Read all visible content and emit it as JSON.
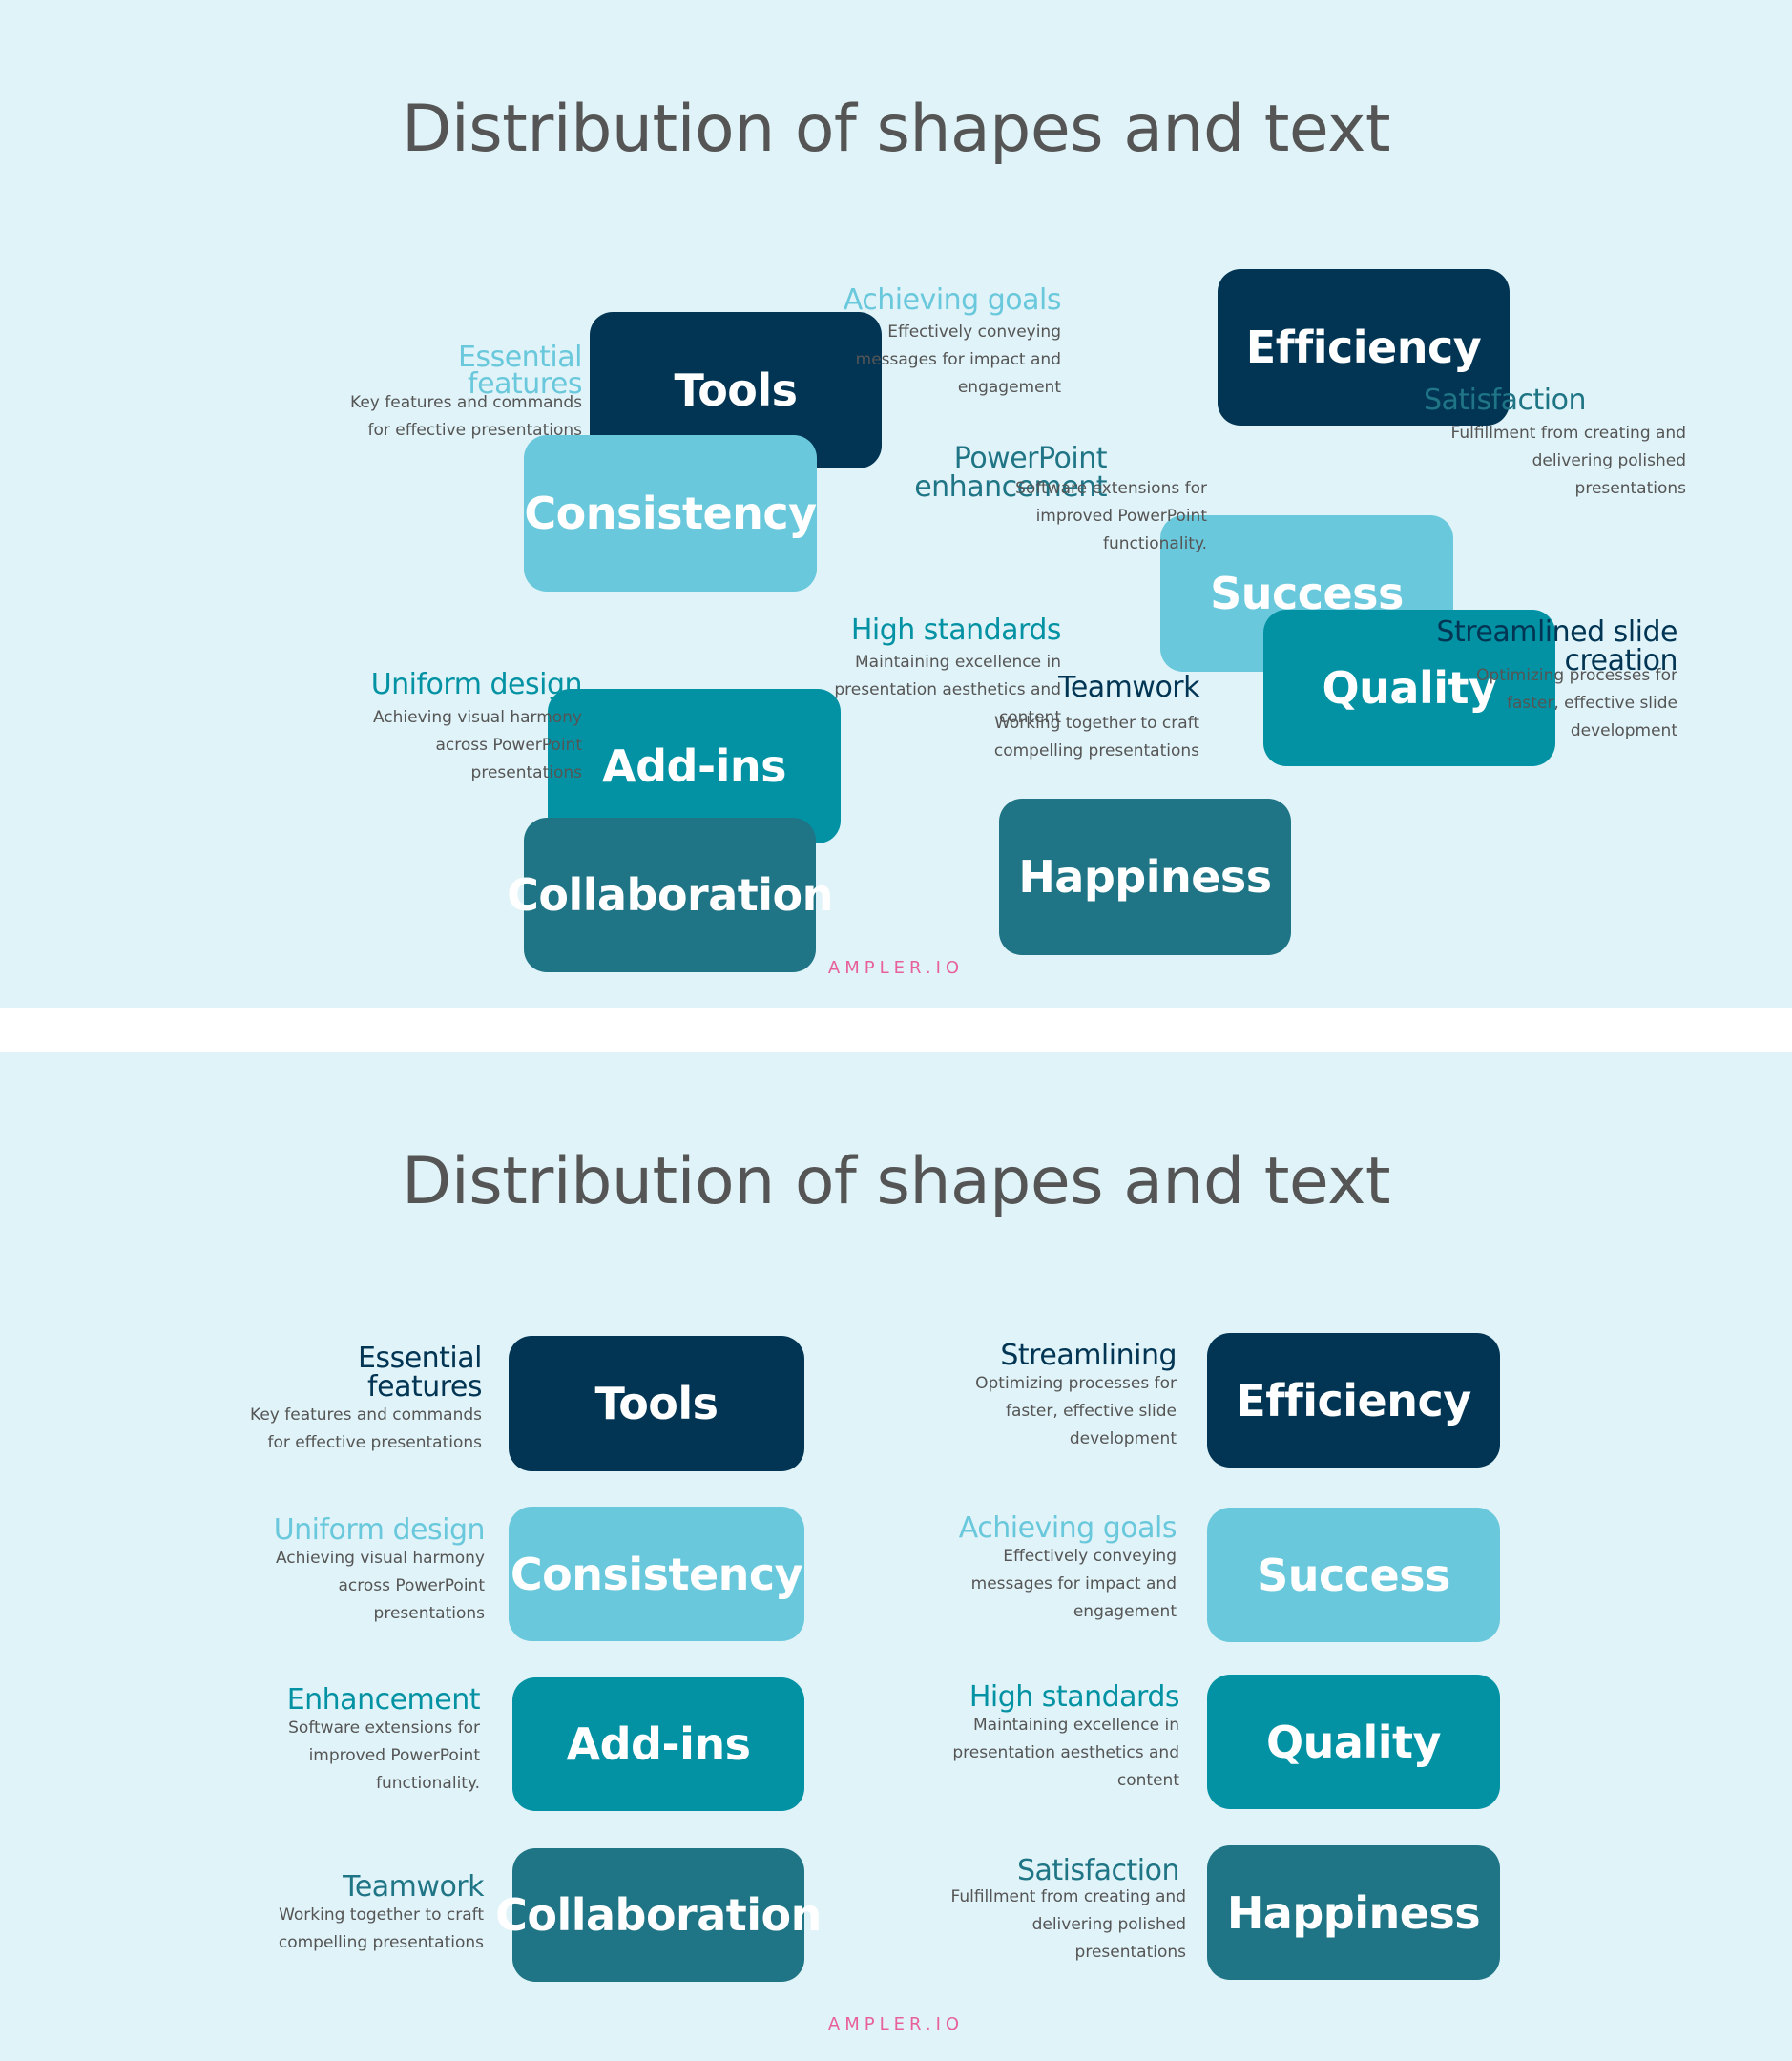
{
  "colors": {
    "navy": "#013553",
    "light_blue": "#69c8db",
    "teal": "#0292a3",
    "dark_teal": "#1f7585",
    "background": "#e0f3f8",
    "footer_pink": "#e8609a"
  },
  "top_slide": {
    "title": "Distribution of shapes and text",
    "boxes": {
      "tools": "Tools",
      "consistency": "Consistency",
      "addins": "Add-ins",
      "collaboration": "Collaboration",
      "efficiency": "Efficiency",
      "success": "Success",
      "quality": "Quality",
      "happiness": "Happiness"
    },
    "labels": {
      "essential": {
        "head": [
          "Essential",
          "features"
        ],
        "desc": [
          "Key features and commands",
          "for effective presentations"
        ]
      },
      "uniform": {
        "head": [
          "Uniform design"
        ],
        "desc": [
          "Achieving visual harmony",
          "across PowerPoint",
          "presentations"
        ]
      },
      "achieving": {
        "head": [
          "Achieving goals"
        ],
        "desc": [
          "Effectively conveying",
          "messages for impact and",
          "engagement"
        ]
      },
      "ppt_enh": {
        "head": [
          "PowerPoint",
          "enhancement"
        ],
        "desc": [
          "Software extensions for",
          "improved PowerPoint",
          "functionality."
        ]
      },
      "high": {
        "head": [
          "High standards"
        ],
        "desc": [
          "Maintaining excellence in",
          "presentation aesthetics and",
          "content"
        ]
      },
      "teamwork": {
        "head": [
          "Teamwork"
        ],
        "desc": [
          "Working together to craft",
          "compelling presentations"
        ]
      },
      "satisfaction": {
        "head": [
          "Satisfaction"
        ],
        "desc": [
          "Fulfillment from creating and",
          "delivering polished",
          "presentations"
        ]
      },
      "streamlined": {
        "head": [
          "Streamlined slide",
          "creation"
        ],
        "desc": [
          "Optimizing processes for",
          "faster, effective slide",
          "development"
        ]
      }
    },
    "footer": "AMPLER.IO"
  },
  "bottom_slide": {
    "title": "Distribution of shapes and text",
    "left_column": [
      {
        "box": "Tools",
        "head": [
          "Essential",
          "features"
        ],
        "desc": [
          "Key features and commands",
          "for effective presentations"
        ]
      },
      {
        "box": "Consistency",
        "head": [
          "Uniform design"
        ],
        "desc": [
          "Achieving visual harmony",
          "across PowerPoint",
          "presentations"
        ]
      },
      {
        "box": "Add-ins",
        "head": [
          "Enhancement"
        ],
        "desc": [
          "Software extensions for",
          "improved PowerPoint",
          "functionality."
        ]
      },
      {
        "box": "Collaboration",
        "head": [
          "Teamwork"
        ],
        "desc": [
          "Working together to craft",
          "compelling presentations"
        ]
      }
    ],
    "right_column": [
      {
        "box": "Efficiency",
        "head": [
          "Streamlining"
        ],
        "desc": [
          "Optimizing processes for",
          "faster, effective slide",
          "development"
        ]
      },
      {
        "box": "Success",
        "head": [
          "Achieving goals"
        ],
        "desc": [
          "Effectively conveying",
          "messages for impact and",
          "engagement"
        ]
      },
      {
        "box": "Quality",
        "head": [
          "High standards"
        ],
        "desc": [
          "Maintaining excellence in",
          "presentation aesthetics and",
          "content"
        ]
      },
      {
        "box": "Happiness",
        "head": [
          "Satisfaction"
        ],
        "desc": [
          "Fulfillment from creating and",
          "delivering polished",
          "presentations"
        ]
      }
    ],
    "footer": "AMPLER.IO"
  }
}
